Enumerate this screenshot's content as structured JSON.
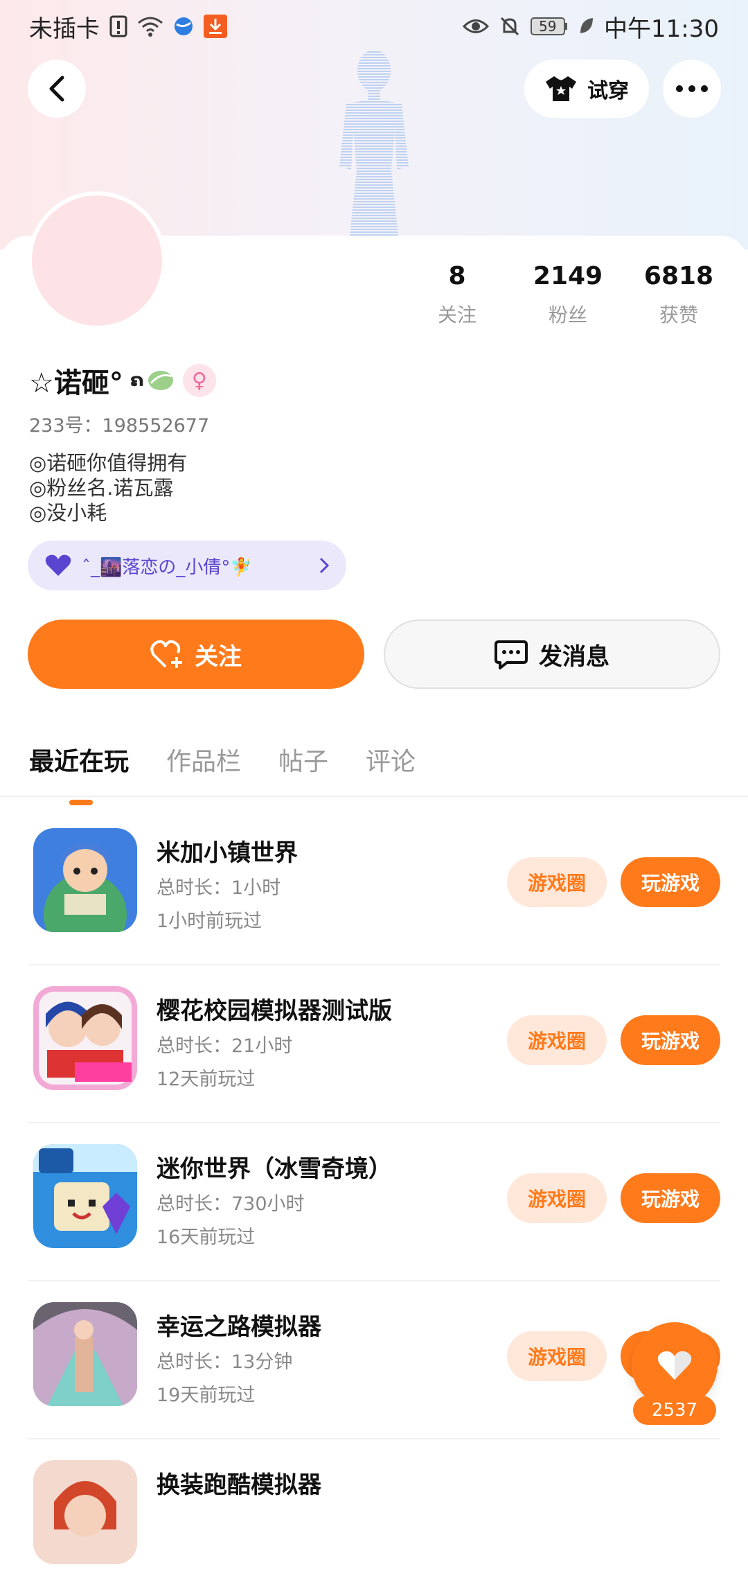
{
  "status_bar": {
    "carrier": "未插卡",
    "battery": "59",
    "time": "中午11:30"
  },
  "nav": {
    "try_on_label": "试穿"
  },
  "profile": {
    "name": "☆诺砸°",
    "uid_label": "233号：",
    "uid": "198552677",
    "bio_lines": [
      "◎诺砸你值得拥有",
      "◎粉丝名.诺瓦露",
      "◎没小耗"
    ],
    "fan_pill": "ˆ_🌆落恋の_小倩°🧚"
  },
  "stats": [
    {
      "value": "8",
      "label": "关注"
    },
    {
      "value": "2149",
      "label": "粉丝"
    },
    {
      "value": "6818",
      "label": "获赞"
    }
  ],
  "actions": {
    "follow": "关注",
    "message": "发消息"
  },
  "tabs": [
    "最近在玩",
    "作品栏",
    "帖子",
    "评论"
  ],
  "games": [
    {
      "title": "米加小镇世界",
      "total": "总时长：1小时",
      "last": "1小时前玩过",
      "circle": "游戏圈",
      "play": "玩游戏"
    },
    {
      "title": "樱花校园模拟器测试版",
      "total": "总时长：21小时",
      "last": "12天前玩过",
      "circle": "游戏圈",
      "play": "玩游戏"
    },
    {
      "title": "迷你世界（冰雪奇境）",
      "total": "总时长：730小时",
      "last": "16天前玩过",
      "circle": "游戏圈",
      "play": "玩游戏"
    },
    {
      "title": "幸运之路模拟器",
      "total": "总时长：13分钟",
      "last": "19天前玩过",
      "circle": "游戏圈",
      "play": "玩游戏"
    },
    {
      "title": "换装跑酷模拟器",
      "total": "",
      "last": "",
      "circle": "",
      "play": ""
    }
  ],
  "floating": {
    "like_count": "2537"
  },
  "colors": {
    "accent": "#ff7a1a",
    "accent_light": "#ffe7d9"
  }
}
